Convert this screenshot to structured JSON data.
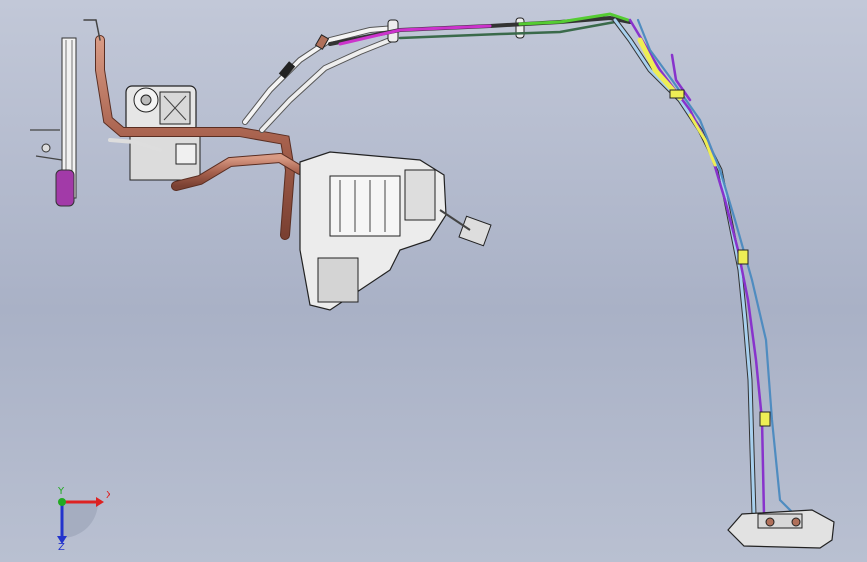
{
  "viewport": {
    "background_top": "#c2c8d8",
    "background_bottom": "#a9b1c6"
  },
  "model": {
    "pipe_colors": {
      "copper": "#b0705a",
      "magenta": "#cc33cc",
      "green": "#55cc33",
      "yellow": "#eeee55",
      "purple": "#8833cc",
      "light_blue": "#a8d0ee",
      "steel_blue": "#4f8cc0",
      "white_hose": "#eeeeee"
    }
  },
  "triad": {
    "x_label": "X",
    "y_label": "Y",
    "z_label": "Z",
    "x_color": "#dd2222",
    "y_color": "#22aa22",
    "z_color": "#2233cc"
  }
}
